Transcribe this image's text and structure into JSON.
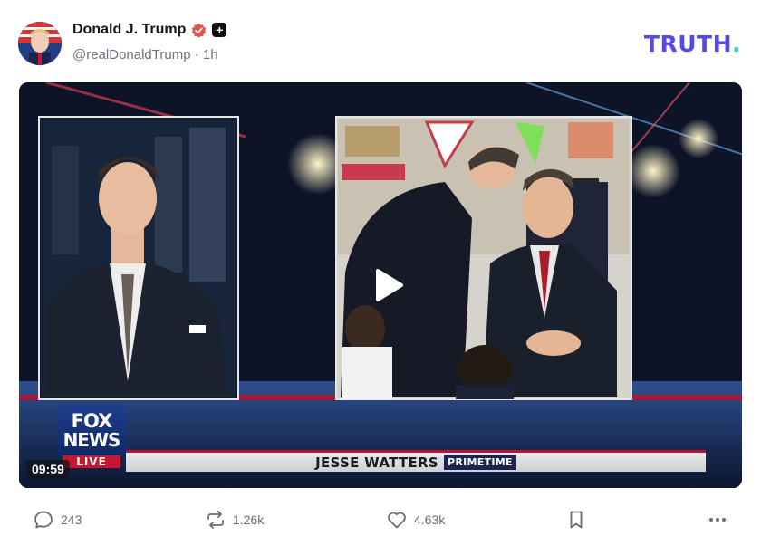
{
  "post": {
    "author": {
      "display_name": "Donald J. Trump",
      "handle_time": "@realDonaldTrump · 1h"
    },
    "brand": {
      "text": "TRUTH",
      "dot": "."
    },
    "media": {
      "duration": "09:59",
      "chyron": {
        "main": "JESSE WATTERS",
        "tag": "PRIMETIME"
      },
      "network_logo": {
        "line1": "FOX",
        "line2": "NEWS",
        "live": "LIVE"
      }
    },
    "actions": {
      "replies": "243",
      "retruths": "1.26k",
      "likes": "4.63k"
    }
  },
  "colors": {
    "brand_purple": "#5448ee",
    "brand_teal": "#3ecbb7",
    "verified": "#e2554f",
    "muted_text": "#6b6b73"
  },
  "icons": {
    "reply": "speech-bubble-icon",
    "retruth": "repost-arrows-icon",
    "like": "heart-icon",
    "bookmark": "bookmark-icon",
    "more": "more-dots-icon",
    "play": "play-icon",
    "verified": "verified-badge-icon",
    "plus": "plus-badge-icon"
  }
}
